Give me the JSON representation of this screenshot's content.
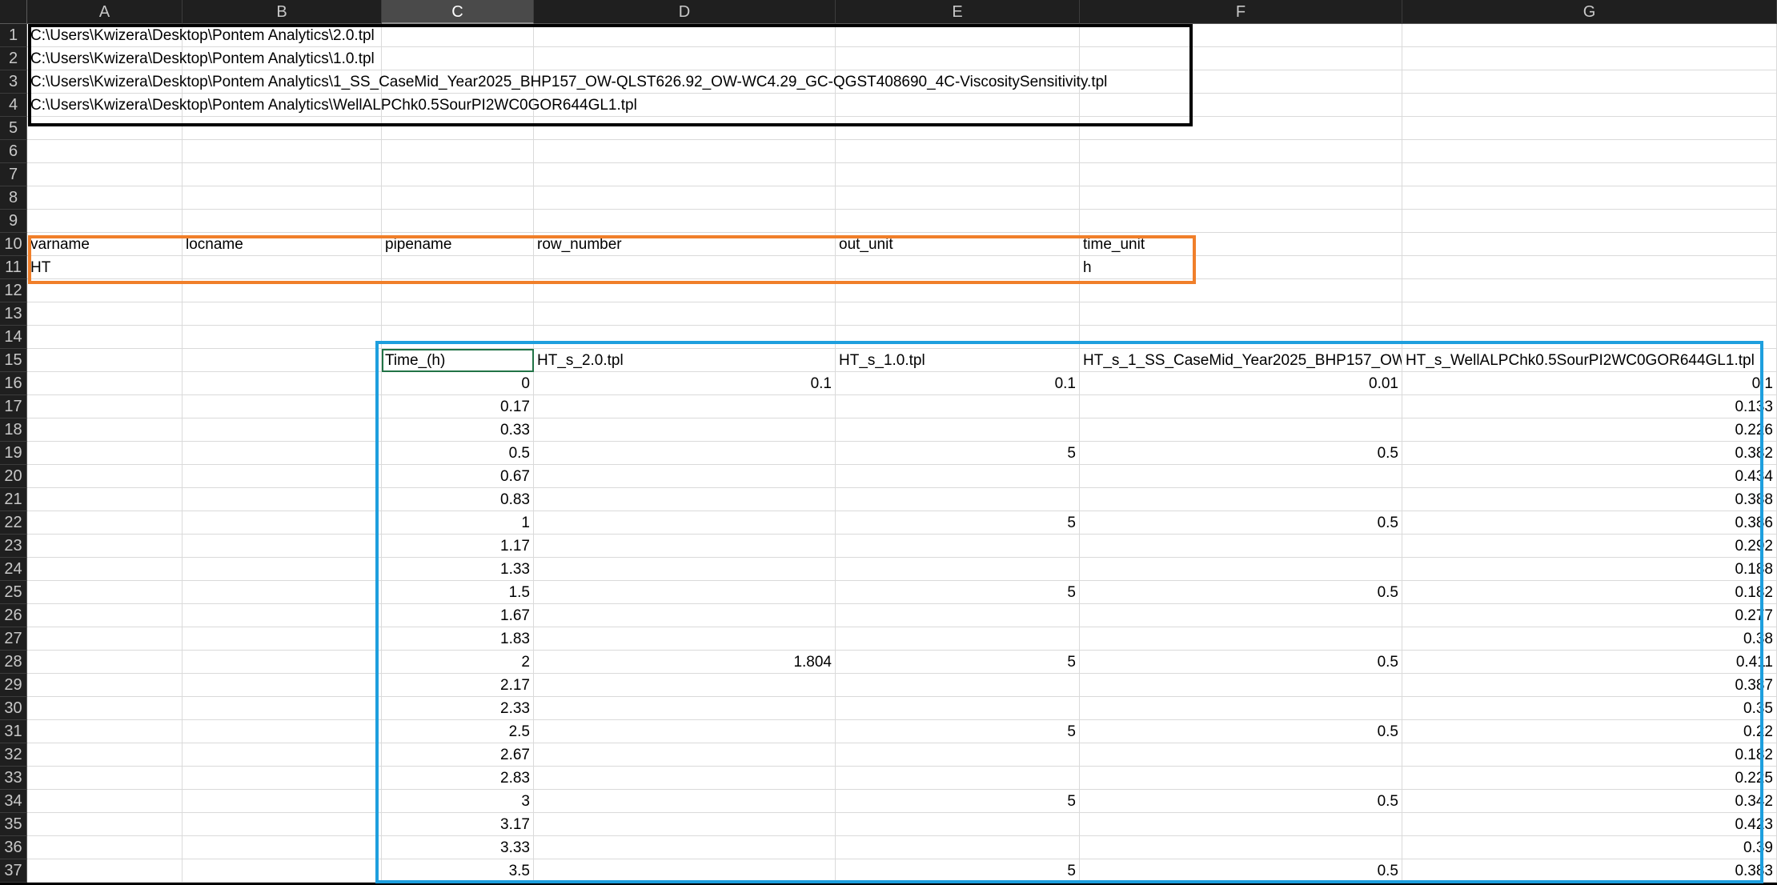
{
  "columns": [
    "A",
    "B",
    "C",
    "D",
    "E",
    "F",
    "G"
  ],
  "selected_column": "C",
  "rows": [
    1,
    2,
    3,
    4,
    5,
    6,
    7,
    8,
    9,
    10,
    11,
    12,
    13,
    14,
    15,
    16,
    17,
    18,
    19,
    20,
    21,
    22,
    23,
    24,
    25,
    26,
    27,
    28,
    29,
    30,
    31,
    32,
    33,
    34,
    35,
    36,
    37
  ],
  "file_paths": [
    "C:\\Users\\Kwizera\\Desktop\\Pontem Analytics\\2.0.tpl",
    "C:\\Users\\Kwizera\\Desktop\\Pontem Analytics\\1.0.tpl",
    "C:\\Users\\Kwizera\\Desktop\\Pontem Analytics\\1_SS_CaseMid_Year2025_BHP157_OW-QLST626.92_OW-WC4.29_GC-QGST408690_4C-ViscositySensitivity.tpl",
    "C:\\Users\\Kwizera\\Desktop\\Pontem Analytics\\WellALPChk0.5SourPI2WC0GOR644GL1.tpl"
  ],
  "params": {
    "headers": [
      "varname",
      "locname",
      "pipename",
      "row_number",
      "out_unit",
      "time_unit"
    ],
    "values": [
      "HT",
      "",
      "",
      "",
      "",
      "h"
    ]
  },
  "results": {
    "headers": [
      "Time_(h)",
      "HT_s_2.0.tpl",
      "HT_s_1.0.tpl",
      "HT_s_1_SS_CaseMid_Year2025_BHP157_OW",
      "HT_s_WellALPChk0.5SourPI2WC0GOR644GL1.tpl"
    ],
    "rows": [
      [
        "0",
        "0.1",
        "0.1",
        "0.01",
        "0.1"
      ],
      [
        "0.17",
        "",
        "",
        "",
        "0.133"
      ],
      [
        "0.33",
        "",
        "",
        "",
        "0.226"
      ],
      [
        "0.5",
        "",
        "5",
        "0.5",
        "0.382"
      ],
      [
        "0.67",
        "",
        "",
        "",
        "0.434"
      ],
      [
        "0.83",
        "",
        "",
        "",
        "0.388"
      ],
      [
        "1",
        "",
        "5",
        "0.5",
        "0.386"
      ],
      [
        "1.17",
        "",
        "",
        "",
        "0.292"
      ],
      [
        "1.33",
        "",
        "",
        "",
        "0.188"
      ],
      [
        "1.5",
        "",
        "5",
        "0.5",
        "0.182"
      ],
      [
        "1.67",
        "",
        "",
        "",
        "0.277"
      ],
      [
        "1.83",
        "",
        "",
        "",
        "0.38"
      ],
      [
        "2",
        "1.804",
        "5",
        "0.5",
        "0.411"
      ],
      [
        "2.17",
        "",
        "",
        "",
        "0.387"
      ],
      [
        "2.33",
        "",
        "",
        "",
        "0.35"
      ],
      [
        "2.5",
        "",
        "5",
        "0.5",
        "0.22"
      ],
      [
        "2.67",
        "",
        "",
        "",
        "0.182"
      ],
      [
        "2.83",
        "",
        "",
        "",
        "0.225"
      ],
      [
        "3",
        "",
        "5",
        "0.5",
        "0.342"
      ],
      [
        "3.17",
        "",
        "",
        "",
        "0.423"
      ],
      [
        "3.33",
        "",
        "",
        "",
        "0.39"
      ],
      [
        "3.5",
        "",
        "5",
        "0.5",
        "0.383"
      ]
    ]
  },
  "colors": {
    "paths_box": "#000000",
    "params_box": "#f07f2a",
    "results_box": "#1e9fde",
    "active_cell": "#217346"
  }
}
